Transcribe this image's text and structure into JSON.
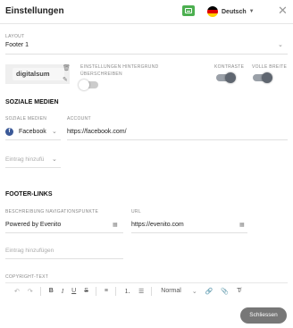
{
  "header": {
    "title": "Einstellungen",
    "language": "Deutsch"
  },
  "layout": {
    "label": "LAYOUT",
    "value": "Footer 1"
  },
  "background": {
    "logo_text": "digitalsum",
    "overwrite_label_1": "EINSTELLUNGEN HINTERGRUND",
    "overwrite_label_2": "ÜBERSCHREIBEN",
    "overwrite_enabled": false
  },
  "contrast": {
    "label": "KONTRASTE",
    "enabled": true
  },
  "full_width": {
    "label": "VOLLE BREITE",
    "enabled": true
  },
  "social": {
    "section_title": "SOZIALE MEDIEN",
    "col_social_label": "SOZIALE MEDIEN",
    "col_account_label": "ACCOUNT",
    "entry_network": "Facebook",
    "entry_account": "https://facebook.com/",
    "add_entry_placeholder": "Eintrag hinzufü"
  },
  "footer_links": {
    "section_title": "FOOTER-LINKS",
    "col_desc_label": "BESCHREIBUNG NAVIGATIONSPUNKTE",
    "col_url_label": "URL",
    "entry_desc": "Powered by Evenito",
    "entry_url": "https://evenito.com",
    "add_entry_placeholder": "Eintrag hinzufügen"
  },
  "copyright": {
    "label": "COPYRIGHT-TEXT",
    "format_select": "Normal"
  },
  "footer": {
    "close_label": "Schliessen"
  },
  "colors": {
    "toggle_on": "#5f6670",
    "close_button": "#777777",
    "keyboard_button": "#4caf50",
    "facebook": "#3b5998"
  }
}
